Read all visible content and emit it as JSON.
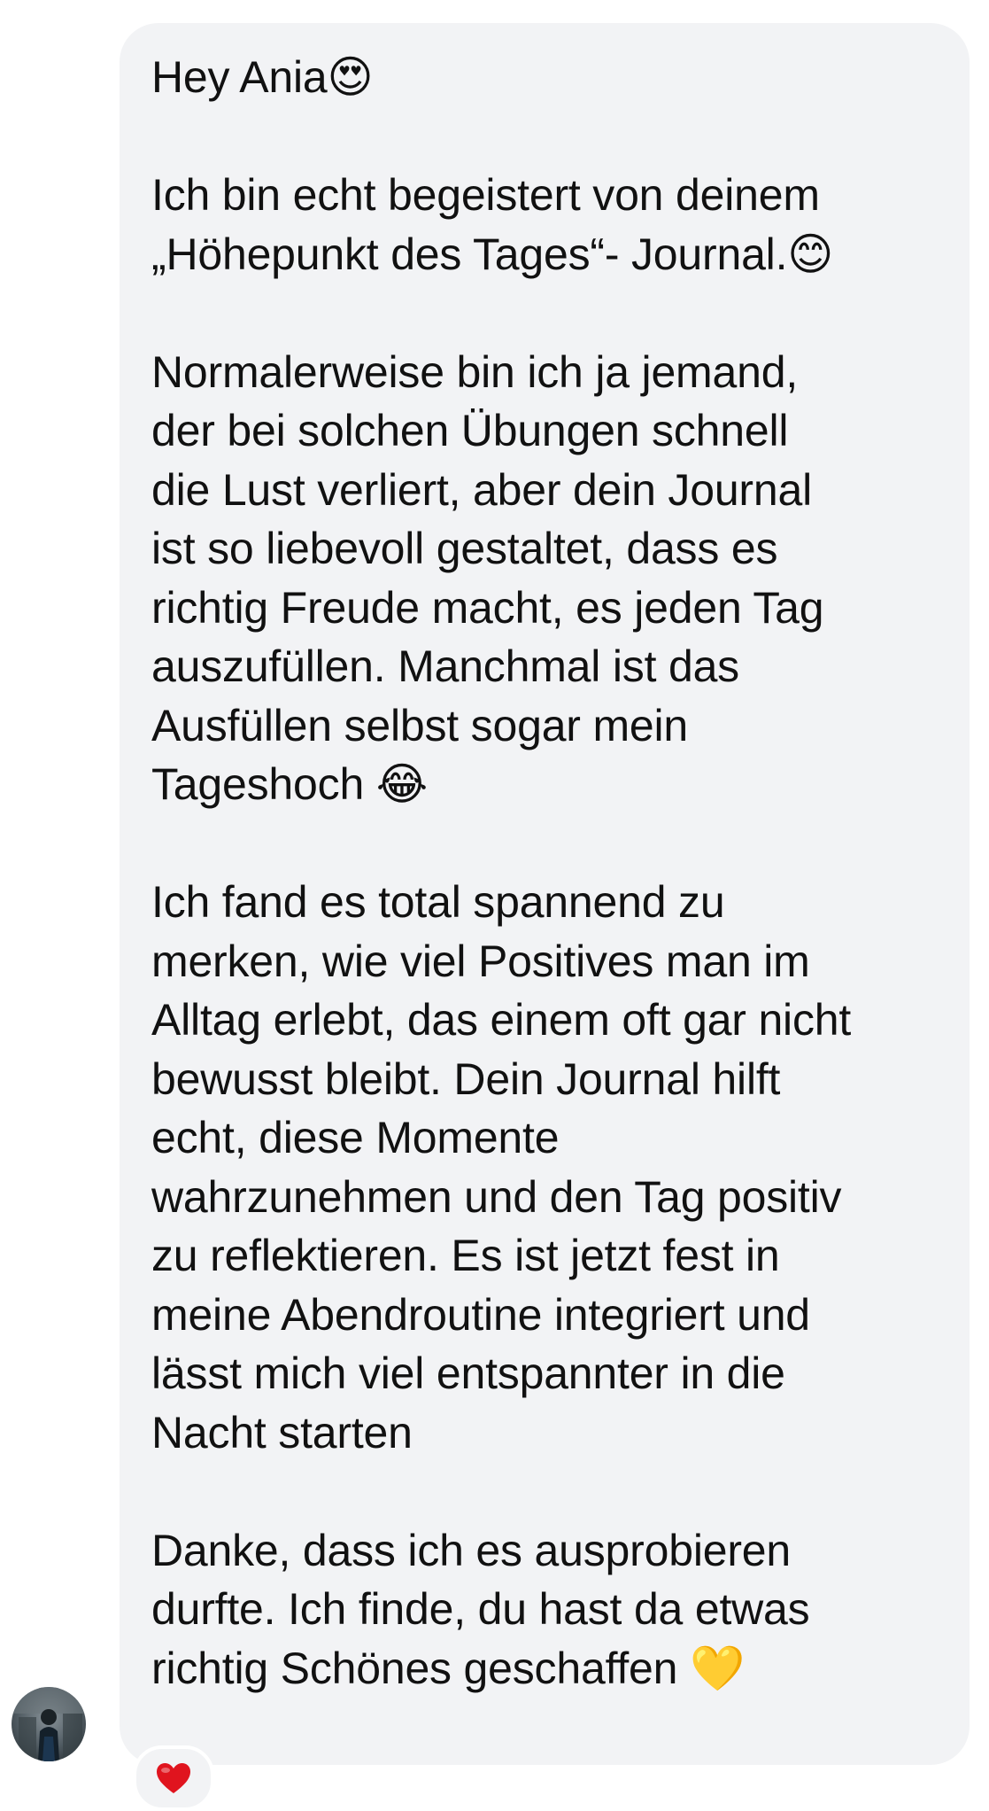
{
  "message": {
    "paragraphs": [
      "Hey Ania😍",
      "Ich bin echt begeistert von deinem\n„Höhepunkt des Tages“- Journal.😊",
      "Normalerweise bin ich ja jemand,\nder bei solchen Übungen schnell\ndie Lust verliert, aber dein Journal\nist so liebevoll gestaltet, dass es\nrichtig Freude macht, es jeden Tag\nauszufüllen. Manchmal ist das\nAusfüllen selbst sogar mein\nTageshoch 😂",
      "Ich fand es total spannend zu\nmerken, wie viel Positives man im\nAlltag erlebt, das einem oft gar nicht\nbewusst bleibt. Dein Journal hilft\necht, diese Momente\nwahrzunehmen und den Tag positiv\nzu reflektieren. Es ist jetzt fest in\nmeine Abendroutine integriert und\nlässt mich viel entspannter in die\nNacht starten",
      "Danke, dass ich es ausprobieren\ndurfte. Ich finde, du hast da etwas\nrichtig Schönes geschaffen 💛"
    ]
  },
  "sender": {
    "avatar_icon": "profile-photo"
  },
  "reaction": {
    "icon": "heart-icon",
    "color": "#e0141e"
  },
  "colors": {
    "bubble_background": "#f2f3f5",
    "text": "#111111",
    "page_background": "#ffffff"
  }
}
